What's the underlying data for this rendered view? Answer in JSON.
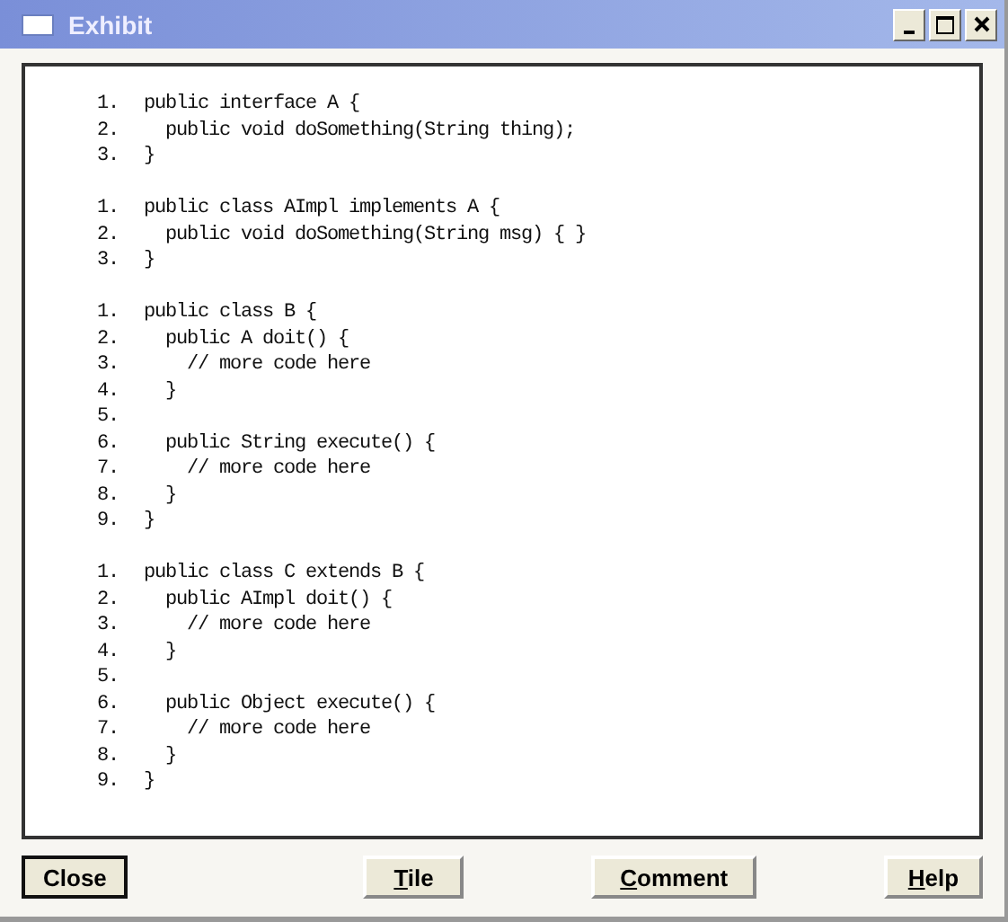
{
  "window": {
    "title": "Exhibit"
  },
  "code_blocks": [
    {
      "lines": [
        {
          "number": "1.",
          "code": "public interface A {"
        },
        {
          "number": "2.",
          "code": "  public void doSomething(String thing);"
        },
        {
          "number": "3.",
          "code": "}"
        }
      ]
    },
    {
      "lines": [
        {
          "number": "1.",
          "code": "public class AImpl implements A {"
        },
        {
          "number": "2.",
          "code": "  public void doSomething(String msg) { }"
        },
        {
          "number": "3.",
          "code": "}"
        }
      ]
    },
    {
      "lines": [
        {
          "number": "1.",
          "code": "public class B {"
        },
        {
          "number": "2.",
          "code": "  public A doit() {"
        },
        {
          "number": "3.",
          "code": "    // more code here"
        },
        {
          "number": "4.",
          "code": "  }"
        },
        {
          "number": "5."
        },
        {
          "number": "6.",
          "code": "  public String execute() {"
        },
        {
          "number": "7.",
          "code": "    // more code here"
        },
        {
          "number": "8.",
          "code": "  }"
        },
        {
          "number": "9.",
          "code": "}"
        }
      ]
    },
    {
      "lines": [
        {
          "number": "1.",
          "code": "public class C extends B {"
        },
        {
          "number": "2.",
          "code": "  public AImpl doit() {"
        },
        {
          "number": "3.",
          "code": "    // more code here"
        },
        {
          "number": "4.",
          "code": "  }"
        },
        {
          "number": "5."
        },
        {
          "number": "6.",
          "code": "  public Object execute() {"
        },
        {
          "number": "7.",
          "code": "    // more code here"
        },
        {
          "number": "8.",
          "code": "  }"
        },
        {
          "number": "9.",
          "code": "}"
        }
      ]
    }
  ],
  "buttons": [
    {
      "rest": "Close",
      "default": true
    },
    {
      "key": "T",
      "rest": "ile",
      "default": false
    },
    {
      "key": "C",
      "rest": "omment",
      "default": false
    },
    {
      "key": "H",
      "rest": "elp",
      "default": false
    }
  ]
}
